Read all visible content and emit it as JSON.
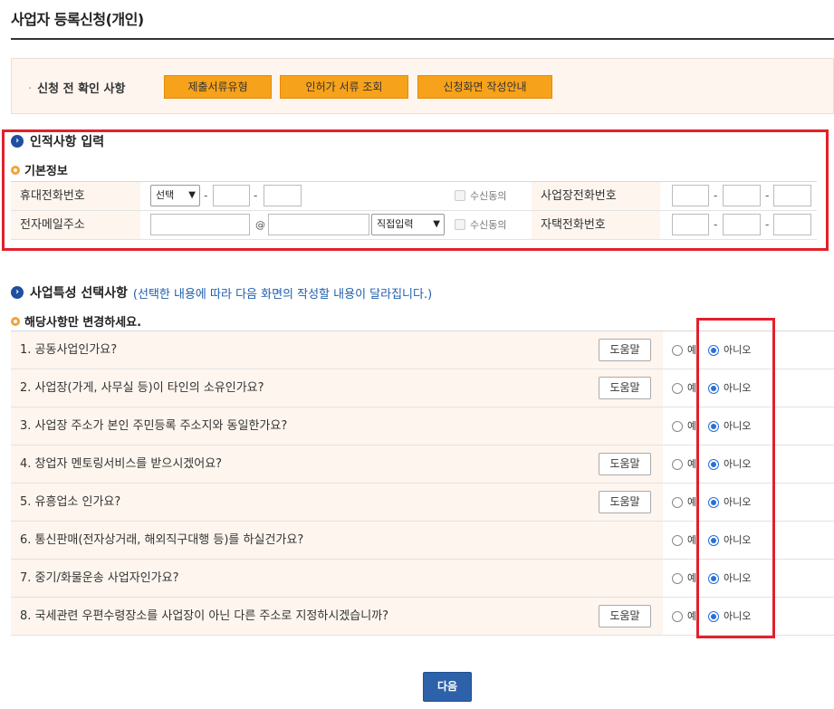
{
  "page": {
    "title": "사업자 등록신청(개인)"
  },
  "precheck": {
    "label": "신청 전 확인 사항",
    "buttons": [
      "제출서류유형",
      "인허가 서류 조회",
      "신청화면 작성안내"
    ]
  },
  "personal": {
    "heading": "인적사항 입력",
    "sub_heading": "기본정보",
    "rows": [
      {
        "label": "휴대전화번호",
        "select": "선택",
        "consent": "수신동의",
        "right_label": "사업장전화번호"
      },
      {
        "label": "전자메일주소",
        "at": "@",
        "select": "직접입력",
        "consent": "수신동의",
        "right_label": "자택전화번호"
      }
    ]
  },
  "business": {
    "heading": "사업특성 선택사항",
    "hint": "(선택한 내용에 따라 다음 화면의 작성할 내용이 달라집니다.)",
    "sub_heading": "해당사항만 변경하세요.",
    "help_label": "도움말",
    "yes_label": "예",
    "no_label": "아니오",
    "questions": [
      {
        "text": "1. 공동사업인가요?",
        "help": true,
        "answer": "아니오"
      },
      {
        "text": "2. 사업장(가게, 사무실 등)이 타인의 소유인가요?",
        "help": true,
        "answer": "아니오"
      },
      {
        "text": "3. 사업장 주소가 본인 주민등록 주소지와 동일한가요?",
        "help": false,
        "answer": "아니오"
      },
      {
        "text": "4. 창업자 멘토링서비스를 받으시겠어요?",
        "help": true,
        "answer": "아니오"
      },
      {
        "text": "5. 유흥업소 인가요?",
        "help": true,
        "answer": "아니오"
      },
      {
        "text": "6. 통신판매(전자상거래, 해외직구대행 등)를 하실건가요?",
        "help": false,
        "answer": "아니오"
      },
      {
        "text": "7. 중기/화물운송 사업자인가요?",
        "help": false,
        "answer": "아니오"
      },
      {
        "text": "8. 국세관련 우편수령장소를 사업장이 아닌 다른 주소로 지정하시겠습니까?",
        "help": true,
        "answer": "아니오"
      }
    ]
  },
  "footer": {
    "next_label": "다음"
  },
  "colors": {
    "highlight": "#e3202c",
    "accent_orange": "#f7a21b",
    "primary_blue": "#2d62aa"
  }
}
